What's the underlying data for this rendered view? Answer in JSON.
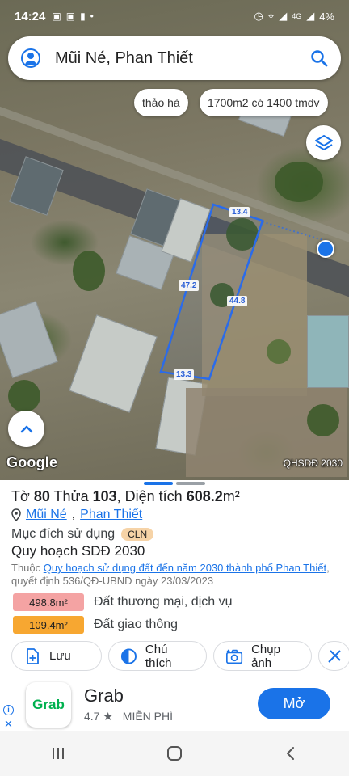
{
  "status_bar": {
    "time": "14:24",
    "battery": "4%",
    "network": "4G"
  },
  "search": {
    "query": "Mũi Né, Phan Thiết"
  },
  "chips": [
    "thảo hà",
    "1700m2 có 1400 tmdv"
  ],
  "map": {
    "measurements": {
      "top": "13.4",
      "right": "44.8",
      "left": "47.2",
      "bottom": "13.3"
    },
    "logo": "Google",
    "layer_label": "QHSDĐ 2030",
    "parcel_color": "#2a6bea"
  },
  "parcel": {
    "title_prefix": "Tờ ",
    "sheet_no": "80",
    "plot_prefix": " Thửa ",
    "plot_no": "103",
    "area_prefix": ", Diện tích ",
    "area": "608.2",
    "area_unit": "m²",
    "location_ward": "Mũi Né",
    "location_sep": ", ",
    "location_city": "Phan Thiết",
    "purpose_label": "Mục đích sử dụng",
    "purpose_code": "CLN",
    "plan_title": "Quy hoạch SDĐ 2030",
    "belongs_prefix": "Thuộc ",
    "plan_link": "Quy hoạch sử dụng đất đến năm 2030 thành phố Phan Thiết",
    "plan_decision": ", quyết định 536/QĐ-UBND ngày 23/03/2023",
    "zones": [
      {
        "area": "498.8m²",
        "label": "Đất thương mại, dịch vụ",
        "color": "#f4a3a3"
      },
      {
        "area": "109.4m²",
        "label": "Đất giao thông",
        "color": "#f7a731"
      }
    ]
  },
  "actions": [
    {
      "label": "Lưu",
      "icon": "add-file-icon"
    },
    {
      "label": "Chú thích",
      "icon": "legend-icon"
    },
    {
      "label": "Chụp ảnh",
      "icon": "camera-icon"
    }
  ],
  "ad": {
    "app_name": "Grab",
    "logo_text": "Grab",
    "rating": "4.7 ★",
    "price": "MIỄN PHÍ",
    "button": "Mở"
  },
  "colors": {
    "accent": "#1a73e8"
  }
}
